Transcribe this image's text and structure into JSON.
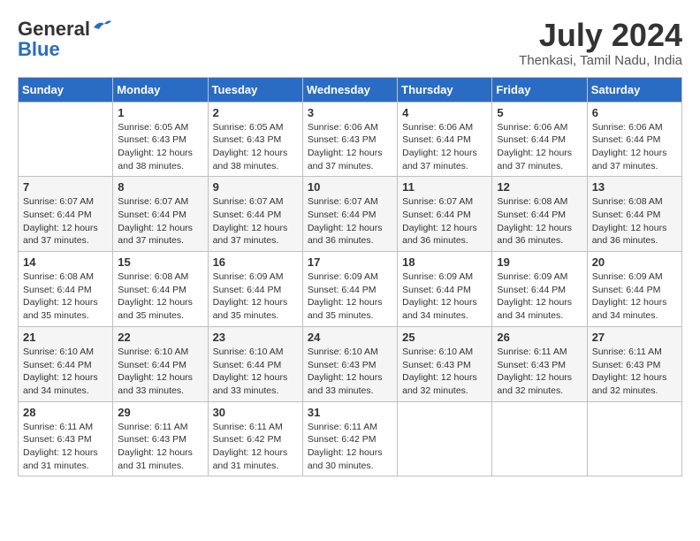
{
  "header": {
    "logo_general": "General",
    "logo_blue": "Blue",
    "month_year": "July 2024",
    "location": "Thenkasi, Tamil Nadu, India"
  },
  "days_of_week": [
    "Sunday",
    "Monday",
    "Tuesday",
    "Wednesday",
    "Thursday",
    "Friday",
    "Saturday"
  ],
  "weeks": [
    [
      {
        "day": "",
        "sunrise": "",
        "sunset": "",
        "daylight": ""
      },
      {
        "day": "1",
        "sunrise": "6:05 AM",
        "sunset": "6:43 PM",
        "daylight": "12 hours and 38 minutes."
      },
      {
        "day": "2",
        "sunrise": "6:05 AM",
        "sunset": "6:43 PM",
        "daylight": "12 hours and 38 minutes."
      },
      {
        "day": "3",
        "sunrise": "6:06 AM",
        "sunset": "6:43 PM",
        "daylight": "12 hours and 37 minutes."
      },
      {
        "day": "4",
        "sunrise": "6:06 AM",
        "sunset": "6:44 PM",
        "daylight": "12 hours and 37 minutes."
      },
      {
        "day": "5",
        "sunrise": "6:06 AM",
        "sunset": "6:44 PM",
        "daylight": "12 hours and 37 minutes."
      },
      {
        "day": "6",
        "sunrise": "6:06 AM",
        "sunset": "6:44 PM",
        "daylight": "12 hours and 37 minutes."
      }
    ],
    [
      {
        "day": "7",
        "sunrise": "6:07 AM",
        "sunset": "6:44 PM",
        "daylight": "12 hours and 37 minutes."
      },
      {
        "day": "8",
        "sunrise": "6:07 AM",
        "sunset": "6:44 PM",
        "daylight": "12 hours and 37 minutes."
      },
      {
        "day": "9",
        "sunrise": "6:07 AM",
        "sunset": "6:44 PM",
        "daylight": "12 hours and 37 minutes."
      },
      {
        "day": "10",
        "sunrise": "6:07 AM",
        "sunset": "6:44 PM",
        "daylight": "12 hours and 36 minutes."
      },
      {
        "day": "11",
        "sunrise": "6:07 AM",
        "sunset": "6:44 PM",
        "daylight": "12 hours and 36 minutes."
      },
      {
        "day": "12",
        "sunrise": "6:08 AM",
        "sunset": "6:44 PM",
        "daylight": "12 hours and 36 minutes."
      },
      {
        "day": "13",
        "sunrise": "6:08 AM",
        "sunset": "6:44 PM",
        "daylight": "12 hours and 36 minutes."
      }
    ],
    [
      {
        "day": "14",
        "sunrise": "6:08 AM",
        "sunset": "6:44 PM",
        "daylight": "12 hours and 35 minutes."
      },
      {
        "day": "15",
        "sunrise": "6:08 AM",
        "sunset": "6:44 PM",
        "daylight": "12 hours and 35 minutes."
      },
      {
        "day": "16",
        "sunrise": "6:09 AM",
        "sunset": "6:44 PM",
        "daylight": "12 hours and 35 minutes."
      },
      {
        "day": "17",
        "sunrise": "6:09 AM",
        "sunset": "6:44 PM",
        "daylight": "12 hours and 35 minutes."
      },
      {
        "day": "18",
        "sunrise": "6:09 AM",
        "sunset": "6:44 PM",
        "daylight": "12 hours and 34 minutes."
      },
      {
        "day": "19",
        "sunrise": "6:09 AM",
        "sunset": "6:44 PM",
        "daylight": "12 hours and 34 minutes."
      },
      {
        "day": "20",
        "sunrise": "6:09 AM",
        "sunset": "6:44 PM",
        "daylight": "12 hours and 34 minutes."
      }
    ],
    [
      {
        "day": "21",
        "sunrise": "6:10 AM",
        "sunset": "6:44 PM",
        "daylight": "12 hours and 34 minutes."
      },
      {
        "day": "22",
        "sunrise": "6:10 AM",
        "sunset": "6:44 PM",
        "daylight": "12 hours and 33 minutes."
      },
      {
        "day": "23",
        "sunrise": "6:10 AM",
        "sunset": "6:44 PM",
        "daylight": "12 hours and 33 minutes."
      },
      {
        "day": "24",
        "sunrise": "6:10 AM",
        "sunset": "6:43 PM",
        "daylight": "12 hours and 33 minutes."
      },
      {
        "day": "25",
        "sunrise": "6:10 AM",
        "sunset": "6:43 PM",
        "daylight": "12 hours and 32 minutes."
      },
      {
        "day": "26",
        "sunrise": "6:11 AM",
        "sunset": "6:43 PM",
        "daylight": "12 hours and 32 minutes."
      },
      {
        "day": "27",
        "sunrise": "6:11 AM",
        "sunset": "6:43 PM",
        "daylight": "12 hours and 32 minutes."
      }
    ],
    [
      {
        "day": "28",
        "sunrise": "6:11 AM",
        "sunset": "6:43 PM",
        "daylight": "12 hours and 31 minutes."
      },
      {
        "day": "29",
        "sunrise": "6:11 AM",
        "sunset": "6:43 PM",
        "daylight": "12 hours and 31 minutes."
      },
      {
        "day": "30",
        "sunrise": "6:11 AM",
        "sunset": "6:42 PM",
        "daylight": "12 hours and 31 minutes."
      },
      {
        "day": "31",
        "sunrise": "6:11 AM",
        "sunset": "6:42 PM",
        "daylight": "12 hours and 30 minutes."
      },
      {
        "day": "",
        "sunrise": "",
        "sunset": "",
        "daylight": ""
      },
      {
        "day": "",
        "sunrise": "",
        "sunset": "",
        "daylight": ""
      },
      {
        "day": "",
        "sunrise": "",
        "sunset": "",
        "daylight": ""
      }
    ]
  ]
}
